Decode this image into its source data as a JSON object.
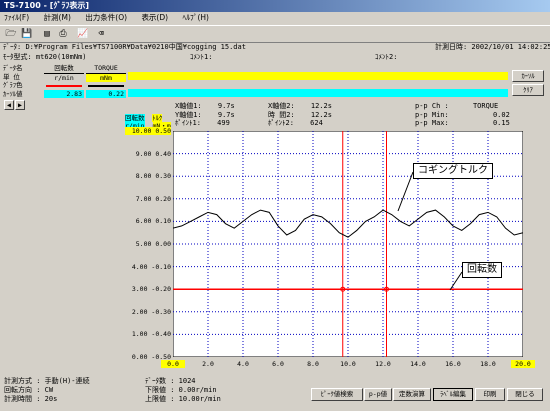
{
  "window": {
    "title": "TS-7100 - [ｸﾞﾗﾌ表示]"
  },
  "menu": [
    "ﾌｧｲﾙ(F)",
    "計測(M)",
    "出力条件(O)",
    "表示(D)",
    "ﾍﾙﾌﾟ(H)"
  ],
  "header": {
    "data_label": "ﾃﾞｰﾀ:",
    "data_path": "D:¥Program Files¥TS7100R¥Data¥0210中国¥cogging 15.dat",
    "datetime": "計測日時: 2002/10/01 14:02:25",
    "model_label": "ﾓｰﾀ型式: mt620(10mNm)",
    "comment1": "ｺﾒﾝﾄ1:",
    "comment2": "ｺﾒﾝﾄ2:"
  },
  "channels": {
    "row_labels": [
      "ﾃﾞｰﾀ名",
      "単 位",
      "ｸﾞﾗﾌ色",
      "ｶｰｿﾙ値"
    ],
    "ch1": {
      "name": "回転数",
      "unit": "r/min",
      "cursor_value": "2.83"
    },
    "ch2": {
      "name": "TORQUE",
      "unit": "mNm",
      "cursor_value": "0.22"
    },
    "cursor_btn": "ｶｰｿﾙ",
    "clear_btn": "ｸﾘｱ"
  },
  "cursor_info": {
    "x1_label": "X軸値1:",
    "x1": "9.7s",
    "y1_label": "Y軸値1:",
    "y1": "9.7s",
    "pt1_label": "ﾎﾟｲﾝﾄ1:",
    "pt1": "499",
    "x2_label": "X軸値2:",
    "x2": "12.2s",
    "y2_label": "時 間2:",
    "y2": "12.2s",
    "pt2_label": "ﾎﾟｲﾝﾄ2:",
    "pt2": "624",
    "pp_ch_label": "p-p Ch :",
    "pp_ch": "TORQUE",
    "pp_min_label": "p-p Min:",
    "pp_min": "0.02",
    "pp_max_label": "p-p Max:",
    "pp_max": "0.15"
  },
  "axis_headers": {
    "l1": "回転数",
    "l2": "ﾄﾙｸ",
    "l3": "r/min",
    "l4": "mN・m"
  },
  "chart_data": {
    "type": "line",
    "x_range": [
      0,
      20.0
    ],
    "y_left_ticks": [
      "10.00",
      "9.00",
      "8.00",
      "7.00",
      "6.00",
      "5.00",
      "4.00",
      "3.00",
      "2.00",
      "1.00",
      "0.00"
    ],
    "y_right_ticks": [
      "0.50",
      "0.40",
      "0.30",
      "0.20",
      "0.10",
      "0.00",
      "-0.10",
      "-0.20",
      "-0.30",
      "-0.40",
      "-0.50"
    ],
    "x_ticks": [
      "0.0",
      "2.0",
      "4.0",
      "6.0",
      "8.0",
      "10.0",
      "12.0",
      "14.0",
      "16.0",
      "18.0",
      "20.0"
    ],
    "cursors": [
      9.7,
      12.2
    ],
    "grid": true,
    "series": [
      {
        "name": "回転数",
        "color": "#ff0000",
        "values_left_axis": [
          [
            0,
            3.0
          ],
          [
            20,
            3.0
          ]
        ]
      },
      {
        "name": "TORQUE",
        "color": "#000000",
        "x": [
          0,
          0.5,
          1,
          1.5,
          2,
          2.5,
          3,
          3.5,
          4,
          4.5,
          5,
          5.5,
          6,
          6.5,
          7,
          7.5,
          8,
          8.5,
          9,
          9.5,
          10,
          10.5,
          11,
          11.5,
          12,
          12.5,
          13,
          13.5,
          14,
          14.5,
          15,
          15.5,
          16,
          16.5,
          17,
          17.5,
          18,
          18.5,
          19,
          19.5,
          20
        ],
        "values": [
          0.07,
          0.08,
          0.1,
          0.12,
          0.14,
          0.13,
          0.09,
          0.07,
          0.1,
          0.13,
          0.15,
          0.14,
          0.08,
          0.04,
          0.06,
          0.11,
          0.13,
          0.12,
          0.09,
          0.05,
          0.03,
          0.06,
          0.1,
          0.12,
          0.15,
          0.13,
          0.1,
          0.08,
          0.11,
          0.14,
          0.15,
          0.12,
          0.08,
          0.06,
          0.09,
          0.13,
          0.14,
          0.12,
          0.07,
          0.04,
          0.05
        ]
      }
    ]
  },
  "annotations": {
    "cogging": "コギングトルク",
    "rotation": "回転数"
  },
  "footer": {
    "method": "計測方式 : 手動(H)-連続",
    "direction": "回転方向 : CW",
    "time": "計測時間 : 20s",
    "count": "ﾃﾞｰﾀ数 : 1024",
    "lower": "下限値 : 0.00r/min",
    "upper": "上限値 : 10.00r/min"
  },
  "buttons": [
    "ﾋﾟｰｸ値検索",
    "p-p値",
    "定数演算",
    "ﾗﾍﾞﾙ編集",
    "印刷",
    "閉じる"
  ]
}
